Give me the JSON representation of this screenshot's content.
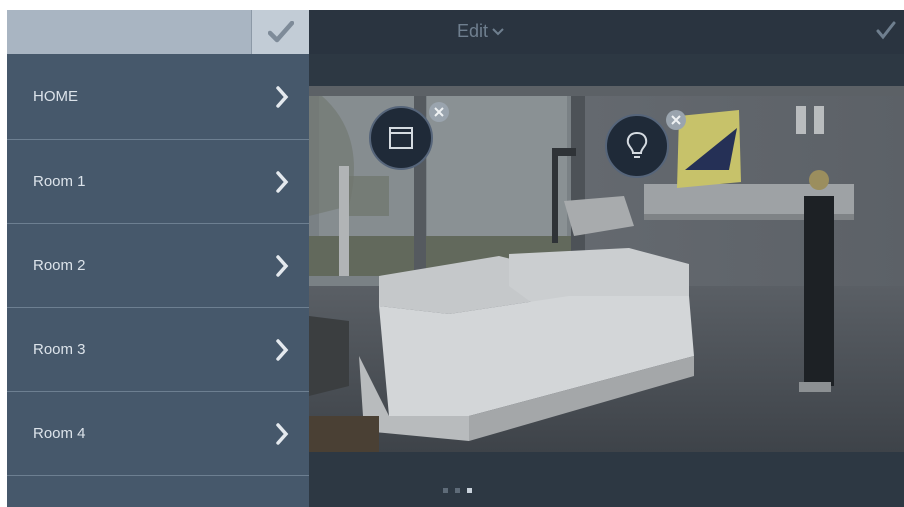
{
  "sidebar": {
    "search_value": "",
    "check_icon": "check-icon",
    "items": [
      {
        "label": "HOME"
      },
      {
        "label": "Room 1"
      },
      {
        "label": "Room 2"
      },
      {
        "label": "Room 3"
      },
      {
        "label": "Room 4"
      }
    ]
  },
  "header": {
    "title": "Edit",
    "title_icon": "chevron-down-icon",
    "confirm_icon": "check-icon"
  },
  "scene": {
    "devices": [
      {
        "icon": "window-blind-icon"
      },
      {
        "icon": "light-bulb-icon"
      }
    ]
  },
  "pager": {
    "pages": 3,
    "active": 3
  },
  "colors": {
    "sidebar_bg": "#46586b",
    "topbar_bg": "#2a3440",
    "accent_text": "#dce3ea"
  }
}
